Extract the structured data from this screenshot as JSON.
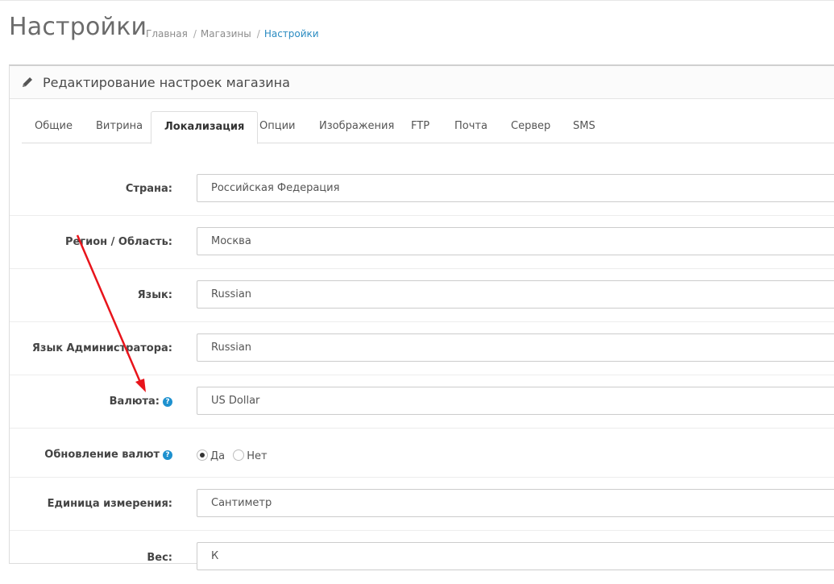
{
  "header": {
    "title": "Настройки",
    "breadcrumb": [
      "Главная",
      "Магазины",
      "Настройки"
    ]
  },
  "panel": {
    "title": "Редактирование настроек магазина",
    "icon": "pencil-icon"
  },
  "tabs": [
    {
      "label": "Общие",
      "active": false
    },
    {
      "label": "Витрина",
      "active": false
    },
    {
      "label": "Локализация",
      "active": true
    },
    {
      "label": "Опции",
      "active": false
    },
    {
      "label": "Изображения",
      "active": false
    },
    {
      "label": "FTP",
      "active": false
    },
    {
      "label": "Почта",
      "active": false
    },
    {
      "label": "Сервер",
      "active": false
    },
    {
      "label": "SMS",
      "active": false
    }
  ],
  "form": {
    "country": {
      "label": "Страна:",
      "value": "Российская Федерация"
    },
    "region": {
      "label": "Регион / Область:",
      "value": "Москва"
    },
    "language": {
      "label": "Язык:",
      "value": "Russian"
    },
    "admin_language": {
      "label": "Язык Администратора:",
      "value": "Russian"
    },
    "currency": {
      "label": "Валюта:",
      "value": "US Dollar",
      "help": "?"
    },
    "currency_update": {
      "label": "Обновление валют",
      "help": "?",
      "options": [
        "Да",
        "Нет"
      ],
      "selected": "Да"
    },
    "length_unit": {
      "label": "Единица измерения:",
      "value": "Сантиметр"
    },
    "weight": {
      "label": "Вес:",
      "value": "К"
    }
  },
  "colors": {
    "accent": "#2a8bc1",
    "help": "#1e91cf",
    "annotation_arrow": "#e8141b"
  }
}
